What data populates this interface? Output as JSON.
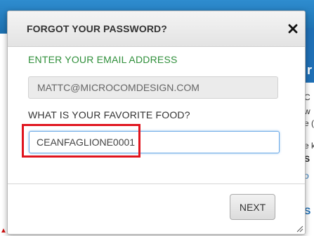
{
  "modal": {
    "title": "FORGOT YOUR PASSWORD?",
    "close_icon": "close-icon",
    "email_label": "ENTER YOUR EMAIL ADDRESS",
    "email_value": "MATTC@MICROCOMDESIGN.COM",
    "food_label": "WHAT IS YOUR FAVORITE FOOD?",
    "food_value": "CEANFAGLIONE0001",
    "next_label": "NEXT"
  },
  "background": {
    "fragments": [
      "r",
      "C",
      "w",
      "e (",
      "e k",
      "S",
      "o",
      "S"
    ]
  },
  "colors": {
    "label_green": "#2f8f3a",
    "focus_blue": "#66a7e6",
    "highlight_red": "#e0141e",
    "page_blue": "#1f6fb5"
  }
}
